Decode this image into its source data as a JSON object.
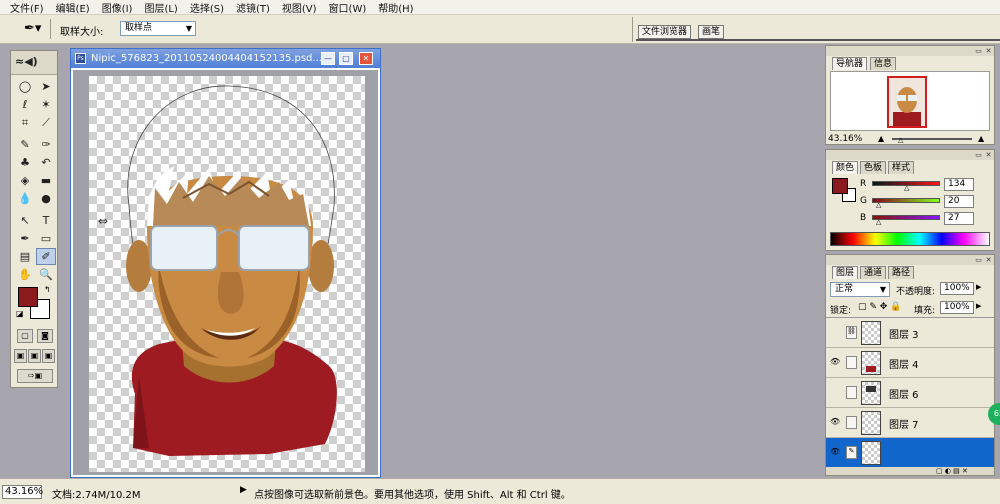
{
  "menubar": {
    "items": [
      "文件(F)",
      "编辑(E)",
      "图像(I)",
      "图层(L)",
      "选择(S)",
      "滤镜(T)",
      "视图(V)",
      "窗口(W)",
      "帮助(H)"
    ]
  },
  "options": {
    "sample_size_label": "取样大小:",
    "sample_size_value": "取样点",
    "well_tabs": [
      "文件浏览器",
      "画笔"
    ]
  },
  "document": {
    "title": "Nipic_576823_20110524004404152135.psd..."
  },
  "navigator": {
    "tabs": [
      "导航器",
      "信息"
    ],
    "zoom": "43.16%"
  },
  "color_panel": {
    "tabs": [
      "颜色",
      "色板",
      "样式"
    ],
    "r_label": "R",
    "r_value": "134",
    "g_label": "G",
    "g_value": "20",
    "b_label": "B",
    "b_value": "27"
  },
  "layers_panel": {
    "tabs": [
      "图层",
      "通道",
      "路径"
    ],
    "blend_mode": "正常",
    "opacity_label": "不透明度:",
    "opacity_value": "100%",
    "lock_label": "锁定:",
    "fill_label": "填充:",
    "fill_value": "100%",
    "layers": [
      {
        "name": "图层 3"
      },
      {
        "name": "图层 4"
      },
      {
        "name": "图层 6"
      },
      {
        "name": "图层 7"
      },
      {
        "name": ""
      }
    ]
  },
  "status": {
    "zoom": "43.16%",
    "doc_info": "文档:2.74M/10.2M",
    "hint": "点按图像可选取新前景色。要用其他选项，使用 Shift、Alt 和 Ctrl 键。"
  },
  "colors": {
    "foreground": "#8b1a1f",
    "background": "#ffffff",
    "title_blue": "#4f7fd6"
  }
}
